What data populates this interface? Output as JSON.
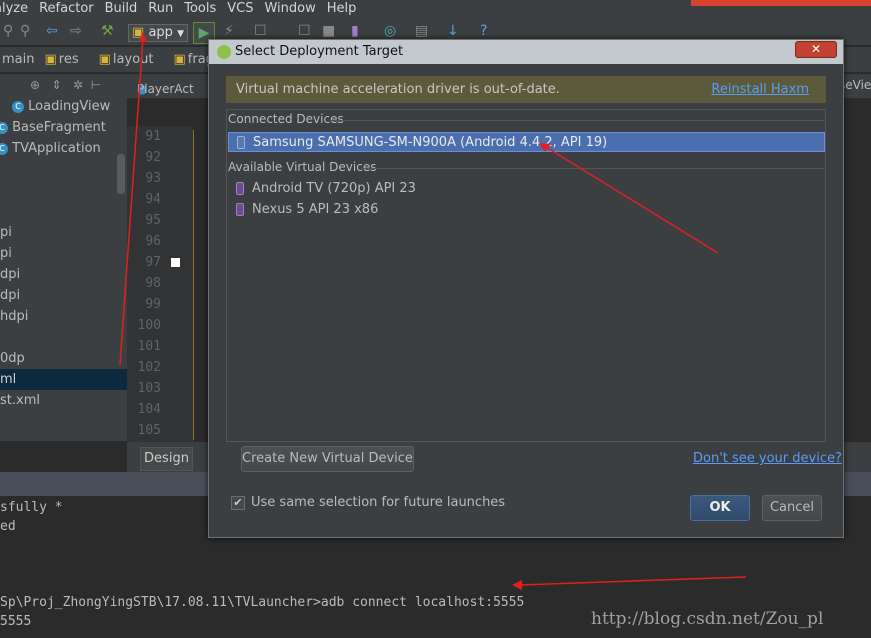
{
  "menu": [
    "alyze",
    "Refactor",
    "Build",
    "Run",
    "Tools",
    "VCS",
    "Window",
    "Help"
  ],
  "toolbar": {
    "run_config": "app"
  },
  "breadcrumb": [
    "main",
    "res",
    "layout",
    "frag"
  ],
  "project": {
    "items": [
      {
        "label": "LoadingView",
        "icon": "class-icon"
      },
      {
        "label": "BaseFragment",
        "icon": "class-icon"
      },
      {
        "label": "TVApplication",
        "icon": "class-icon"
      },
      {
        "label": "",
        "icon": ""
      },
      {
        "label": "",
        "icon": ""
      },
      {
        "label": "",
        "icon": ""
      },
      {
        "label": "pi",
        "icon": ""
      },
      {
        "label": "pi",
        "icon": ""
      },
      {
        "label": "dpi",
        "icon": ""
      },
      {
        "label": "dpi",
        "icon": ""
      },
      {
        "label": "hdpi",
        "icon": ""
      },
      {
        "label": "",
        "icon": ""
      },
      {
        "label": "0dp",
        "icon": ""
      },
      {
        "label": "ml",
        "icon": ""
      },
      {
        "label": "st.xml",
        "icon": ""
      }
    ]
  },
  "editor": {
    "tab_left": "PlayerAct",
    "tab_right": "seVie",
    "line_numbers": [
      "91",
      "92",
      "93",
      "94",
      "95",
      "96",
      "97",
      "98",
      "99",
      "100",
      "101",
      "102",
      "103",
      "104",
      "105"
    ],
    "design_tab": "Design"
  },
  "console": {
    "lines": [
      "sfully *",
      "ed",
      "Sp\\Proj_ZhongYingSTB\\17.08.11\\TVLauncher>adb connect localhost:5555",
      "5555"
    ]
  },
  "watermark": "http://blog.csdn.net/Zou_pl",
  "dialog": {
    "title": "Select Deployment Target",
    "close": "✕",
    "warning": "Virtual machine acceleration driver is out-of-date.",
    "warning_link": "Reinstall Haxm",
    "connected_header": "Connected Devices",
    "connected": [
      "Samsung SAMSUNG-SM-N900A (Android 4.4.2, API 19)"
    ],
    "available_header": "Available Virtual Devices",
    "available": [
      "Android TV (720p) API 23",
      "Nexus 5 API 23 x86"
    ],
    "create_button": "Create New Virtual Device",
    "help_link": "Don't see your device?",
    "checkbox_label": "Use same selection for future launches",
    "checkbox_checked": true,
    "ok": "OK",
    "cancel": "Cancel"
  },
  "colors": {
    "selection": "#4b6eaf",
    "link": "#589df6",
    "annotation": "#e02020"
  }
}
